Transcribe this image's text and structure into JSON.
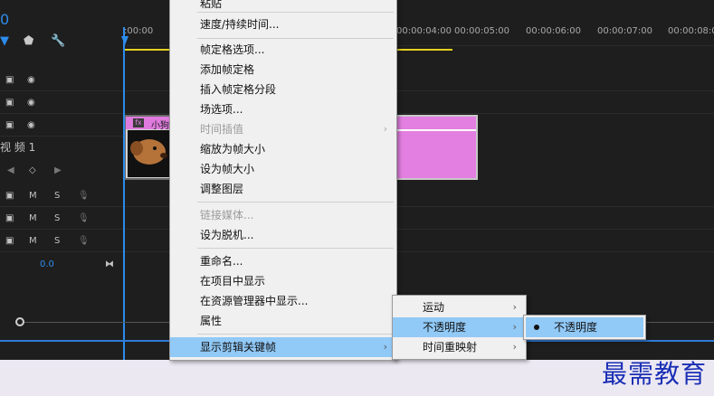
{
  "timeline": {
    "timecode_fragment": "0",
    "ruler_ticks": [
      ":00:00",
      "00:00:04:00",
      "00:00:05:00",
      "00:00:06:00",
      "00:00:07:00",
      "00:00:08:0"
    ],
    "track_label": "视 频 1",
    "audio_level": "0.0",
    "audio_M": "M",
    "audio_S": "S",
    "clip1_title": "小狗",
    "clip1_fx": "fx"
  },
  "context_menu": {
    "items": [
      {
        "label": "粘贴",
        "enabled": true
      },
      {
        "label": "速度/持续时间...",
        "enabled": true
      },
      {
        "label": "帧定格选项...",
        "enabled": true
      },
      {
        "label": "添加帧定格",
        "enabled": true
      },
      {
        "label": "插入帧定格分段",
        "enabled": true
      },
      {
        "label": "场选项...",
        "enabled": true
      },
      {
        "label": "时间插值",
        "enabled": false,
        "submenu": true
      },
      {
        "label": "缩放为帧大小",
        "enabled": true
      },
      {
        "label": "设为帧大小",
        "enabled": true
      },
      {
        "label": "调整图层",
        "enabled": true
      },
      {
        "label": "链接媒体...",
        "enabled": false
      },
      {
        "label": "设为脱机...",
        "enabled": true
      },
      {
        "label": "重命名...",
        "enabled": true
      },
      {
        "label": "在项目中显示",
        "enabled": true
      },
      {
        "label": "在资源管理器中显示...",
        "enabled": true
      },
      {
        "label": "属性",
        "enabled": true
      },
      {
        "label": "显示剪辑关键帧",
        "enabled": true,
        "submenu": true,
        "highlighted": true
      }
    ],
    "arrow_glyph": "›"
  },
  "submenu_1": {
    "items": [
      {
        "label": "运动"
      },
      {
        "label": "不透明度",
        "highlighted": true
      },
      {
        "label": "时间重映射"
      }
    ]
  },
  "submenu_2": {
    "items": [
      {
        "label": "不透明度",
        "checked": true
      }
    ]
  },
  "watermark": "最需教育",
  "colors": {
    "accent_blue": "#2d8ceb",
    "clip_pink": "#e37fe0",
    "menu_highlight": "#91c9f7",
    "watermark": "#1a2fb5"
  }
}
